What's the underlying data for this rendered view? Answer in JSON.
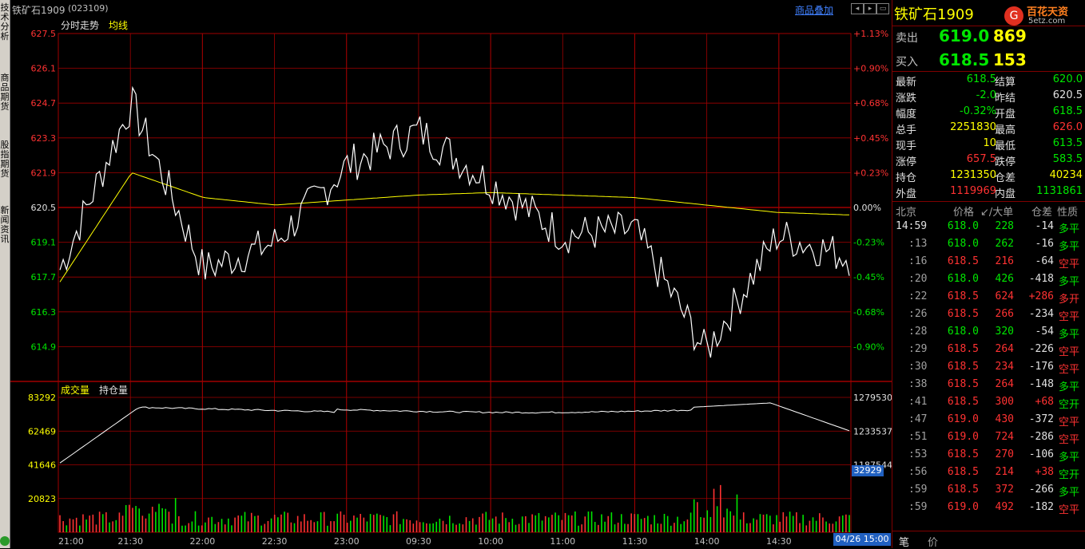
{
  "app": {
    "title": "铁矿石1909",
    "code": "(023109)",
    "overlay_link": "商品叠加",
    "watermark": "5etz.com",
    "logo_text": "百花天资"
  },
  "left_tabs": [
    "技术分析",
    "商品期货",
    "股指期货",
    "新闻资讯"
  ],
  "chart": {
    "legend_main": "分时走势",
    "legend_avg": "均线",
    "legend_vol": "成交量",
    "legend_oi": "持仓量",
    "price_ticks": [
      "627.5",
      "626.1",
      "624.7",
      "623.3",
      "621.9",
      "620.5",
      "619.1",
      "617.7",
      "616.3",
      "614.9"
    ],
    "pct_ticks": [
      "+1.13%",
      "+0.90%",
      "+0.68%",
      "+0.45%",
      "+0.23%",
      "0.00%",
      "-0.23%",
      "-0.45%",
      "-0.68%",
      "-0.90%"
    ],
    "vol_ticks": [
      "83292",
      "62469",
      "41646",
      "20823"
    ],
    "oi_ticks": [
      "1279530",
      "1233537",
      "1187544"
    ],
    "oi_current": "32929",
    "time_ticks": [
      "21:00",
      "21:30",
      "22:00",
      "22:30",
      "23:00",
      "09:30",
      "10:00",
      "11:00",
      "11:30",
      "14:00",
      "14:30"
    ],
    "date_label": "04/26 15:00",
    "colors": {
      "price": "#ffffff",
      "avg": "#ffff00",
      "grid": "#a00000",
      "up": "#ff3232",
      "down": "#00e600"
    }
  },
  "chart_data": {
    "type": "line",
    "title": "",
    "x": [
      "21:00",
      "21:30",
      "22:00",
      "22:30",
      "23:00",
      "09:30",
      "10:00",
      "11:00",
      "11:30",
      "14:00",
      "14:30",
      "15:00"
    ],
    "series": [
      {
        "name": "分时走势",
        "values": [
          618.0,
          624.7,
          618.0,
          619.1,
          622.2,
          623.6,
          621.5,
          619.4,
          619.6,
          614.7,
          619.4,
          618.5
        ]
      },
      {
        "name": "均线",
        "values": [
          617.5,
          621.9,
          620.9,
          620.6,
          620.8,
          621.0,
          621.1,
          621.0,
          620.9,
          620.6,
          620.3,
          620.2
        ]
      }
    ],
    "ylim": [
      614.0,
      627.5
    ],
    "volume": {
      "name": "成交量",
      "ylim": [
        0,
        83292
      ]
    },
    "open_interest": {
      "name": "持仓量",
      "ylim": [
        1187544,
        1279530
      ]
    }
  },
  "quote": {
    "sell_label": "卖出",
    "sell_price": "619.0",
    "sell_vol": "869",
    "buy_label": "买入",
    "buy_price": "618.5",
    "buy_vol": "153",
    "rows": [
      {
        "l1": "最新",
        "v1": "618.5",
        "c1": "green",
        "l2": "结算",
        "v2": "620.0",
        "c2": "green"
      },
      {
        "l1": "涨跌",
        "v1": "-2.0",
        "c1": "green",
        "l2": "昨结",
        "v2": "620.5",
        "c2": "white"
      },
      {
        "l1": "幅度",
        "v1": "-0.32%",
        "c1": "green",
        "l2": "开盘",
        "v2": "618.5",
        "c2": "green"
      },
      {
        "l1": "总手",
        "v1": "2251830",
        "c1": "yellow",
        "l2": "最高",
        "v2": "626.0",
        "c2": "red"
      },
      {
        "l1": "现手",
        "v1": "10",
        "c1": "yellow",
        "l2": "最低",
        "v2": "613.5",
        "c2": "green"
      },
      {
        "l1": "涨停",
        "v1": "657.5",
        "c1": "red",
        "l2": "跌停",
        "v2": "583.5",
        "c2": "green"
      },
      {
        "l1": "持仓",
        "v1": "1231350",
        "c1": "yellow",
        "l2": "仓差",
        "v2": "40234",
        "c2": "yellow"
      },
      {
        "l1": "外盘",
        "v1": "1119969",
        "c1": "red",
        "l2": "内盘",
        "v2": "1131861",
        "c2": "green"
      }
    ],
    "tick_header": {
      "time": "北京",
      "price": "价格",
      "vol": "↙/大单",
      "oi": "仓差",
      "nature": "性质"
    },
    "ticks": [
      {
        "t": "14:59",
        "p": "618.0",
        "pc": "green",
        "v": "228",
        "d": "-14",
        "n": "多平",
        "nc": "green"
      },
      {
        "t": ":13",
        "p": "618.0",
        "pc": "green",
        "v": "262",
        "d": "-16",
        "n": "多平",
        "nc": "green"
      },
      {
        "t": ":16",
        "p": "618.5",
        "pc": "red",
        "v": "216",
        "d": "-64",
        "n": "空平",
        "nc": "red"
      },
      {
        "t": ":20",
        "p": "618.0",
        "pc": "green",
        "v": "426",
        "d": "-418",
        "n": "多平",
        "nc": "green"
      },
      {
        "t": ":22",
        "p": "618.5",
        "pc": "red",
        "v": "624",
        "d": "+286",
        "n": "多开",
        "nc": "red"
      },
      {
        "t": ":26",
        "p": "618.5",
        "pc": "red",
        "v": "266",
        "d": "-234",
        "n": "空平",
        "nc": "red"
      },
      {
        "t": ":28",
        "p": "618.0",
        "pc": "green",
        "v": "320",
        "d": "-54",
        "n": "多平",
        "nc": "green"
      },
      {
        "t": ":29",
        "p": "618.5",
        "pc": "red",
        "v": "264",
        "d": "-226",
        "n": "空平",
        "nc": "red"
      },
      {
        "t": ":30",
        "p": "618.5",
        "pc": "red",
        "v": "234",
        "d": "-176",
        "n": "空平",
        "nc": "red"
      },
      {
        "t": ":38",
        "p": "618.5",
        "pc": "red",
        "v": "264",
        "d": "-148",
        "n": "多平",
        "nc": "green"
      },
      {
        "t": ":41",
        "p": "618.5",
        "pc": "red",
        "v": "300",
        "d": "+68",
        "n": "空开",
        "nc": "green"
      },
      {
        "t": ":47",
        "p": "619.0",
        "pc": "red",
        "v": "430",
        "d": "-372",
        "n": "空平",
        "nc": "red"
      },
      {
        "t": ":51",
        "p": "619.0",
        "pc": "red",
        "v": "724",
        "d": "-286",
        "n": "空平",
        "nc": "red"
      },
      {
        "t": ":53",
        "p": "618.5",
        "pc": "red",
        "v": "270",
        "d": "-106",
        "n": "多平",
        "nc": "green"
      },
      {
        "t": ":56",
        "p": "618.5",
        "pc": "red",
        "v": "214",
        "d": "+38",
        "n": "空开",
        "nc": "green"
      },
      {
        "t": ":59",
        "p": "618.5",
        "pc": "red",
        "v": "372",
        "d": "-266",
        "n": "多平",
        "nc": "green"
      },
      {
        "t": ":59",
        "p": "619.0",
        "pc": "red",
        "v": "492",
        "d": "-182",
        "n": "空平",
        "nc": "red"
      }
    ],
    "bottom_tabs": [
      "笔",
      "价"
    ]
  }
}
